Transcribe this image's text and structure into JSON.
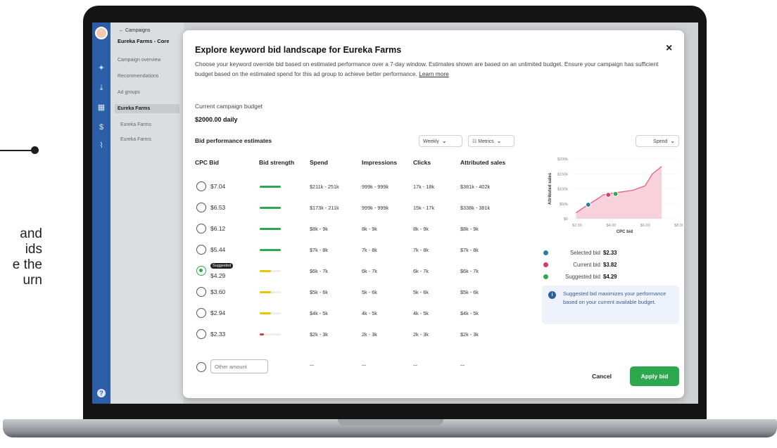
{
  "callout": {
    "lines": [
      "and",
      "ids",
      "e the",
      "urn"
    ]
  },
  "sidebar": {
    "back_label": "← Campaigns",
    "campaign_name": "Eureka Farms - Core",
    "nav": [
      "Campaign overview",
      "Recommendations",
      "Ad groups",
      "Eureka Farms",
      "Eureka Farms",
      "Eureka Farms"
    ]
  },
  "modal": {
    "title": "Explore keyword bid landscape for Eureka Farms",
    "close_glyph": "×",
    "description": "Choose your keyword override bid based on estimated performance over a 7-day window. Estimates shown are based on an unlimited budget. Ensure your campaign has sufficient budget based on the estimated spend for this ad group to achieve better performance.",
    "learn_more": "Learn more",
    "budget_label": "Current campaign budget",
    "budget_value": "$2000.00 daily",
    "estimates_title": "Bid performance estimates",
    "dropdowns": {
      "period": "Weekly",
      "metrics": "Metrics",
      "chart_metric": "Spend"
    },
    "columns": [
      "CPC Bid",
      "Bid strength",
      "Spend",
      "Impressions",
      "Clicks",
      "Attributed sales"
    ],
    "rows": [
      {
        "bid": "$7.04",
        "strength": "green",
        "spend": "$211k - 251k",
        "impressions": "999k - 999k",
        "clicks": "17k - 18k",
        "sales": "$381k - 402k",
        "selected": false
      },
      {
        "bid": "$6.53",
        "strength": "green",
        "spend": "$173k - 211k",
        "impressions": "999k - 999k",
        "clicks": "15k - 17k",
        "sales": "$338k - 381k",
        "selected": false
      },
      {
        "bid": "$6.12",
        "strength": "green",
        "spend": "$8k - 9k",
        "impressions": "8k - 9k",
        "clicks": "8k - 9k",
        "sales": "$8k - 9k",
        "selected": false
      },
      {
        "bid": "$5.44",
        "strength": "green",
        "spend": "$7k - 8k",
        "impressions": "7k - 8k",
        "clicks": "7k - 8k",
        "sales": "$7k - 8k",
        "selected": false
      },
      {
        "bid": "$4.29",
        "strength": "yellow",
        "spend": "$6k - 7k",
        "impressions": "6k - 7k",
        "clicks": "6k - 7k",
        "sales": "$6k - 7k",
        "selected": true,
        "badge": "Suggested"
      },
      {
        "bid": "$3.60",
        "strength": "yellow",
        "spend": "$5k - 6k",
        "impressions": "5k - 6k",
        "clicks": "5k - 6k",
        "sales": "$5k - 6k",
        "selected": false
      },
      {
        "bid": "$2.94",
        "strength": "yellow",
        "spend": "$4k - 5k",
        "impressions": "4k - 5k",
        "clicks": "4k - 5k",
        "sales": "$4k - 5k",
        "selected": false
      },
      {
        "bid": "$2.33",
        "strength": "red",
        "spend": "$2k - 3k",
        "impressions": "2k - 3k",
        "clicks": "2k - 3k",
        "sales": "$2k - 3k",
        "selected": false
      }
    ],
    "other_placeholder": "Other amount",
    "other_dash": "--",
    "legend": [
      {
        "label": "Selected bid",
        "value": "$2.33",
        "color": "#2a7fa0"
      },
      {
        "label": "Current bid",
        "value": "$3.82",
        "color": "#d93a6a"
      },
      {
        "label": "Suggested bid",
        "value": "$4.29",
        "color": "#2ea84e"
      }
    ],
    "info_icon": "i",
    "info_text": "Suggested bid maximizes your performance based on your current available budget.",
    "cancel_label": "Cancel",
    "apply_label": "Apply bid"
  },
  "chart_data": {
    "type": "area",
    "xlabel": "CPC bid",
    "ylabel": "Attributed sales",
    "x_ticks": [
      "$2.00",
      "$4.00",
      "$6.00",
      "$8.00"
    ],
    "y_ticks": [
      "$200k",
      "$150k",
      "$100k",
      "$50k",
      "$0"
    ],
    "x": [
      2.33,
      2.94,
      3.6,
      3.82,
      4.29,
      5.44,
      6.12,
      6.53,
      7.04
    ],
    "y": [
      20,
      45,
      70,
      80,
      85,
      95,
      110,
      150,
      175
    ],
    "xlim": [
      2.0,
      8.0
    ],
    "ylim": [
      0,
      200
    ],
    "markers": [
      {
        "name": "Selected bid",
        "x": 3.0,
        "y": 47,
        "color": "#2a7fa0"
      },
      {
        "name": "Current bid",
        "x": 4.1,
        "y": 80,
        "color": "#d93a6a"
      },
      {
        "name": "Suggested bid",
        "x": 4.5,
        "y": 83,
        "color": "#2ea84e"
      }
    ],
    "fill_color": "#f6c9d5",
    "line_color": "#e06a8c"
  }
}
